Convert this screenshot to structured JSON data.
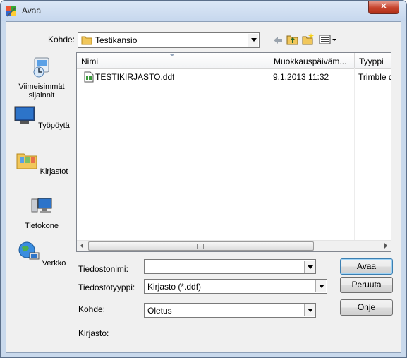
{
  "window": {
    "title": "Avaa",
    "close_glyph": "✕"
  },
  "lookin": {
    "label": "Kohde:",
    "value": "Testikansio"
  },
  "toolbar": {
    "back_icon": "back-arrow-icon",
    "up_icon": "up-folder-icon",
    "new_folder_icon": "new-folder-icon",
    "view_icon": "view-menu-icon"
  },
  "places": [
    {
      "label": "Viimeisimmät sijainnit",
      "icon": "recent-places-icon"
    },
    {
      "label": "Työpöytä",
      "icon": "desktop-icon"
    },
    {
      "label": "Kirjastot",
      "icon": "libraries-icon"
    },
    {
      "label": "Tietokone",
      "icon": "computer-icon"
    },
    {
      "label": "Verkko",
      "icon": "network-icon"
    }
  ],
  "file_list": {
    "columns": [
      "Nimi",
      "Muokkauspäiväm...",
      "Tyyppi"
    ],
    "rows": [
      {
        "name": "TESTIKIRJASTO.ddf",
        "modified": "9.1.2013 11:32",
        "type": "Trimble d"
      }
    ]
  },
  "form": {
    "filename_label": "Tiedostonimi:",
    "filename_value": "",
    "filetype_label": "Tiedostotyyppi:",
    "filetype_value": "Kirjasto (*.ddf)",
    "target_label": "Kohde:",
    "target_value": "Oletus",
    "library_label": "Kirjasto:"
  },
  "buttons": {
    "open": "Avaa",
    "cancel": "Peruuta",
    "help": "Ohje"
  },
  "scroll": {
    "grip": "III"
  }
}
